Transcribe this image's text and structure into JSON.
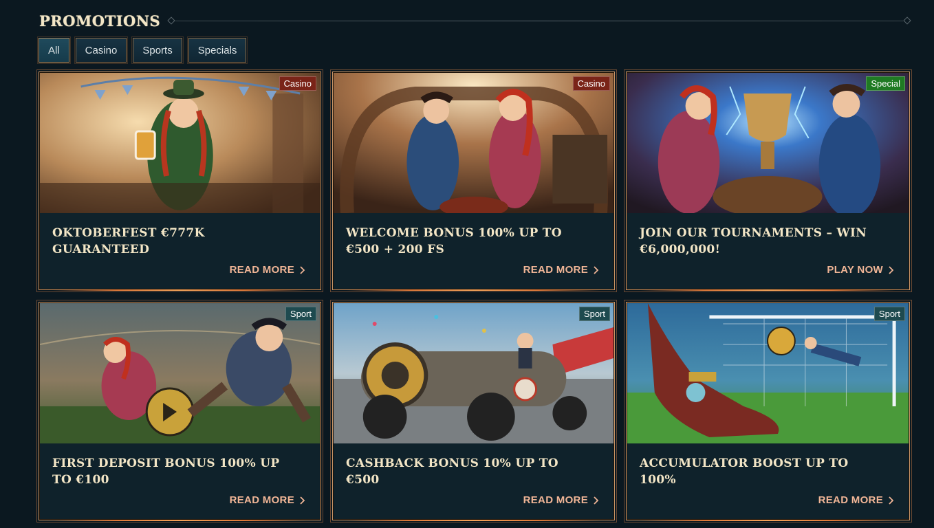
{
  "page": {
    "title": "PROMOTIONS"
  },
  "filters": [
    {
      "label": "All",
      "active": true
    },
    {
      "label": "Casino",
      "active": false
    },
    {
      "label": "Sports",
      "active": false
    },
    {
      "label": "Specials",
      "active": false
    }
  ],
  "promotions": [
    {
      "badge": "Casino",
      "title": "OKTOBERFEST €777K GUARANTEED",
      "cta": "READ MORE",
      "art": "oktoberfest-illustration"
    },
    {
      "badge": "Casino",
      "title": "WELCOME BONUS 100% UP TO €500 + 200 FS",
      "cta": "READ MORE",
      "art": "casino-welcome-illustration"
    },
    {
      "badge": "Special",
      "title": "JOIN OUR TOURNAMENTS – WIN €6,000,000!",
      "cta": "PLAY NOW",
      "art": "tournament-trophy-illustration"
    },
    {
      "badge": "Sport",
      "title": "FIRST DEPOSIT BONUS 100% UP TO €100",
      "cta": "READ MORE",
      "art": "football-players-illustration"
    },
    {
      "badge": "Sport",
      "title": "CASHBACK BONUS 10% UP TO €500",
      "cta": "READ MORE",
      "art": "race-car-illustration"
    },
    {
      "badge": "Sport",
      "title": "ACCUMULATOR BOOST UP TO 100%",
      "cta": "READ MORE",
      "art": "goal-kick-illustration"
    }
  ],
  "colors": {
    "background": "#0b1820",
    "card": "#0f222b",
    "cta": "#f0b596",
    "badge_casino": "#7a2418",
    "badge_special": "#1f7a23",
    "badge_sport": "#1e4a4f"
  }
}
